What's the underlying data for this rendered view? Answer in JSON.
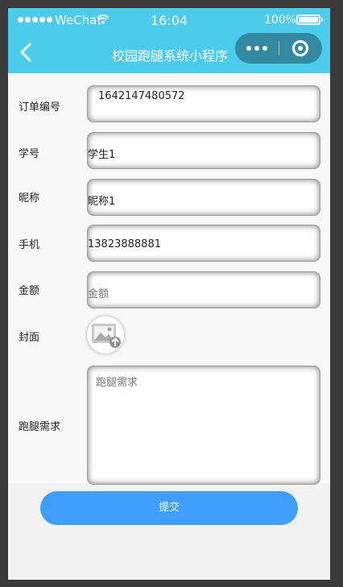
{
  "status_bar": {
    "carrier": "WeChat",
    "time": "16:04",
    "battery_percent": "100%"
  },
  "nav": {
    "title": "校园跑腿系统小程序",
    "back_icon": "chevron-left-icon",
    "more_icon": "more-dots-icon",
    "close_icon": "target-close-icon"
  },
  "form": {
    "order_no": {
      "label": "订单编号",
      "value": "1642147480572"
    },
    "student_no": {
      "label": "学号",
      "value": "学生1"
    },
    "nickname": {
      "label": "昵称",
      "value": "昵称1"
    },
    "phone": {
      "label": "手机",
      "value": "13823888881"
    },
    "amount": {
      "label": "金额",
      "placeholder": "金额"
    },
    "cover": {
      "label": "封面",
      "icon": "image-upload-icon"
    },
    "requirement": {
      "label": "跑腿需求",
      "placeholder": "跑腿需求"
    }
  },
  "submit_label": "提交",
  "colors": {
    "header_bg": "#4ccbea",
    "button_bg": "#409eff",
    "page_bg": "#f2f2f2"
  }
}
